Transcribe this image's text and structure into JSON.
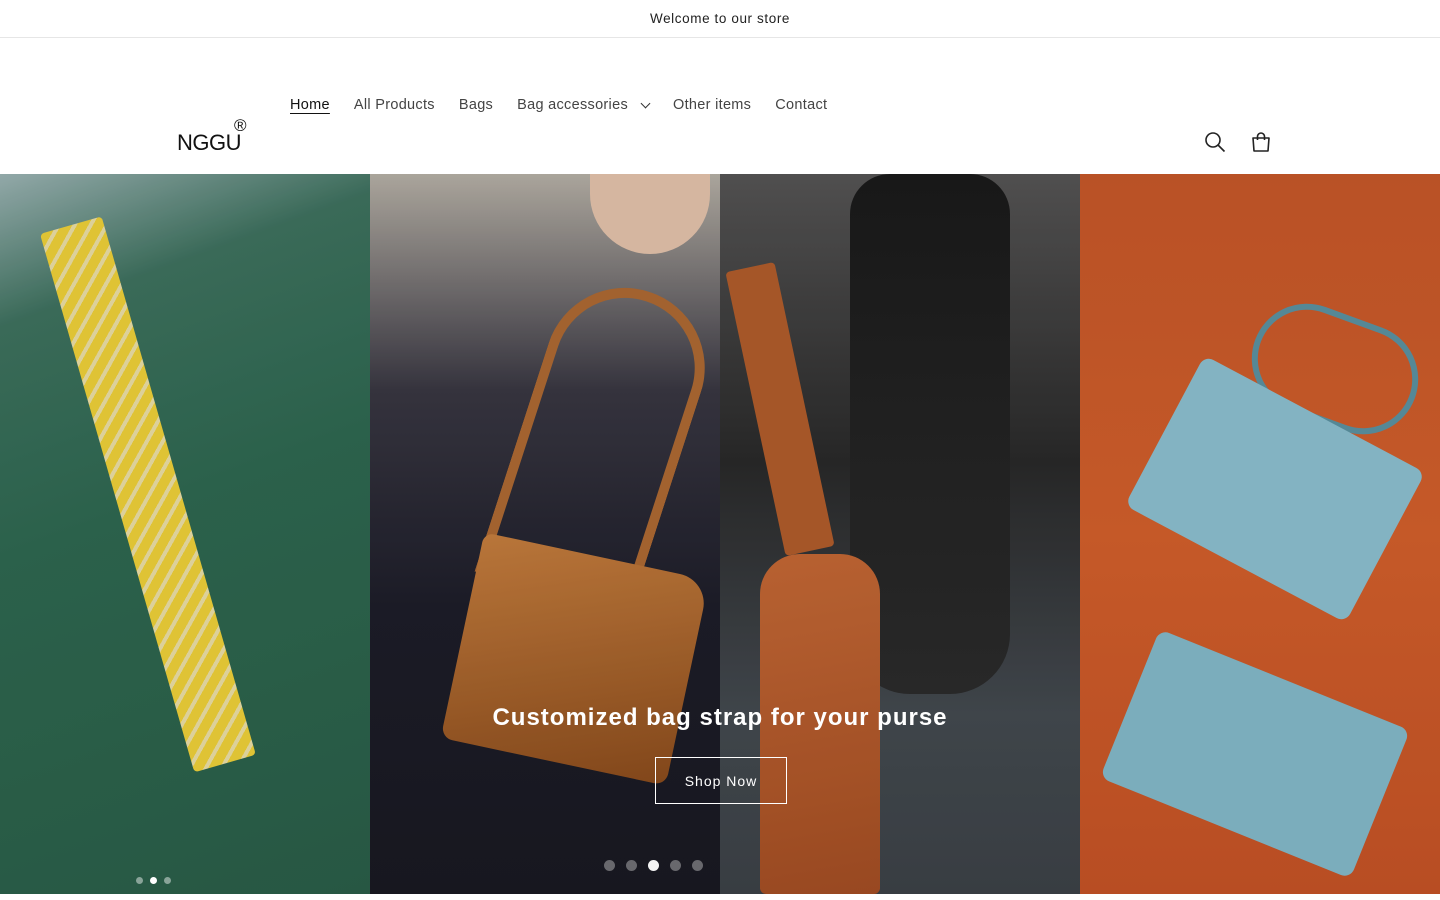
{
  "announcement": {
    "text": "Welcome to our store"
  },
  "logo": {
    "text": "NGGU",
    "registered": "®"
  },
  "nav": {
    "items": [
      {
        "label": "Home",
        "active": true
      },
      {
        "label": "All Products"
      },
      {
        "label": "Bags"
      },
      {
        "label": "Bag accessories",
        "has_dropdown": true
      },
      {
        "label": "Other items"
      },
      {
        "label": "Contact"
      }
    ]
  },
  "header_icons": [
    "search-icon",
    "cart-icon"
  ],
  "hero": {
    "caption": "Customized bag strap for your purse",
    "button_label": "Shop Now",
    "slides_total": 5,
    "active_slide": 3
  }
}
